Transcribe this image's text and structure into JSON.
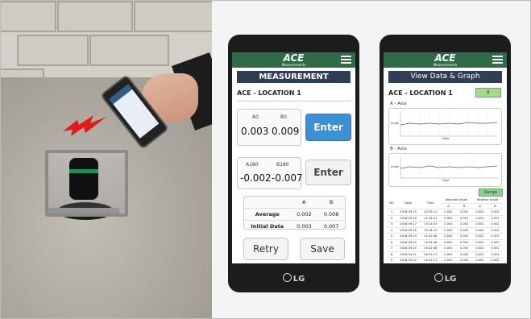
{
  "phone1": {
    "logo": "ACE",
    "logo_sub": "Measurements",
    "title": "MEASUREMENT",
    "location": "ACE - LOCATION 1",
    "a0_label": "A0",
    "b0_label": "B0",
    "a0_value": "0.003",
    "b0_value": "0.009",
    "enter1": "Enter",
    "a180_label": "A180",
    "b180_label": "B180",
    "a180_value": "-0.002",
    "b180_value": "-0.007",
    "enter2": "Enter",
    "table": {
      "col_a": "A",
      "col_b": "B",
      "rows": [
        {
          "label": "Average",
          "a": "0.002",
          "b": "0.008"
        },
        {
          "label": "Initial Data",
          "a": "0.003",
          "b": "0.007"
        }
      ]
    },
    "retry": "Retry",
    "save": "Save",
    "brand": "LG"
  },
  "phone2": {
    "logo": "ACE",
    "logo_sub": "Measurements",
    "title": "View Data & Graph",
    "location": "ACE - LOCATION 1",
    "b_button": "B",
    "a_axis": "A - Axis",
    "b_axis": "B - Axis",
    "range_button": "Range",
    "x_label": "Date",
    "y_label": "Angle",
    "table_headers": [
      "NO",
      "Date",
      "Time",
      "Absolute Angle",
      "Relative Angle"
    ],
    "sub_headers": [
      "A",
      "B",
      "A",
      "B"
    ],
    "rows": [
      [
        "1",
        "2016.09.15",
        "10:25:21",
        "0.002",
        "0.001",
        "0.001",
        "0.002"
      ],
      [
        "2",
        "2016.09.16",
        "11:24:13",
        "0.002",
        "0.001",
        "0.001",
        "0.001"
      ],
      [
        "3",
        "2016.09.17",
        "13:11:53",
        "0.001",
        "0.002",
        "0.001",
        "0.002"
      ],
      [
        "4",
        "2016.09.18",
        "12:14:15",
        "0.002",
        "0.002",
        "0.002",
        "0.001"
      ],
      [
        "5",
        "2016.09.19",
        "11:02:46",
        "0.002",
        "0.001",
        "0.001",
        "0.001"
      ],
      [
        "6",
        "2016.09.20",
        "13:04:36",
        "0.002",
        "0.002",
        "0.001",
        "0.002"
      ],
      [
        "7",
        "2016.09.20",
        "15:01:08",
        "0.001",
        "0.001",
        "0.002",
        "0.001"
      ],
      [
        "8",
        "2016.09.21",
        "16:21:11",
        "0.002",
        "0.002",
        "0.001",
        "0.001"
      ],
      [
        "9",
        "2016.09.22",
        "14:51:11",
        "0.001",
        "0.002",
        "0.002",
        "0.002"
      ]
    ],
    "brand": "LG"
  }
}
